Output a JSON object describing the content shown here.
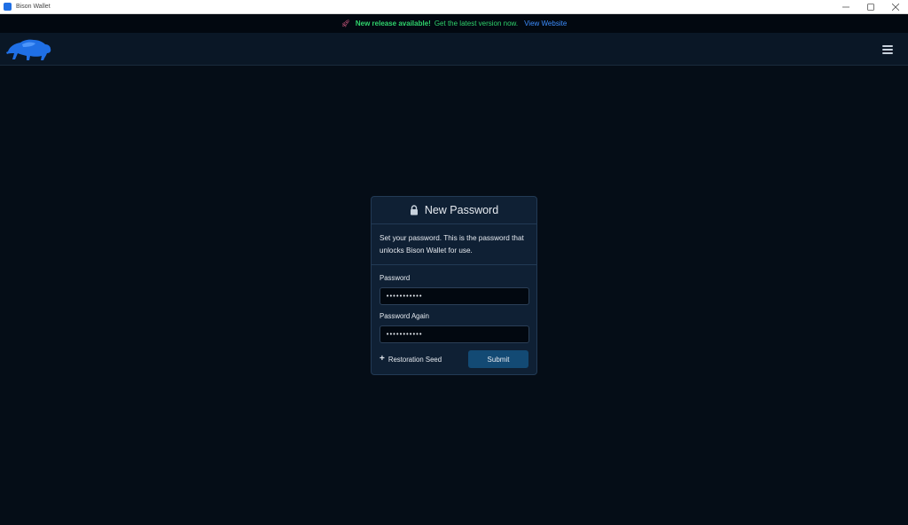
{
  "window": {
    "title": "Bison Wallet",
    "icon": "bison-app-icon"
  },
  "banner": {
    "icon": "rocket-icon",
    "strong": "New release available!",
    "text": "Get the latest version now.",
    "link": "View Website"
  },
  "header": {
    "logo": "bison-logo",
    "menu_icon": "hamburger-menu-icon"
  },
  "card": {
    "title": "New Password",
    "title_icon": "lock-icon",
    "description": "Set your password. This is the password that unlocks Bison Wallet for use.",
    "fields": [
      {
        "label": "Password",
        "value": "•••••••••••"
      },
      {
        "label": "Password Again",
        "value": "•••••••••••"
      }
    ],
    "seed_toggle": "Restoration Seed",
    "submit": "Submit"
  },
  "colors": {
    "background": "#050d17",
    "header": "#0a1726",
    "card": "#0f2034",
    "accent_button": "#134a74",
    "banner_green": "#2fd36c",
    "banner_link": "#3d8eff",
    "logo_blue": "#1f6fe5"
  }
}
